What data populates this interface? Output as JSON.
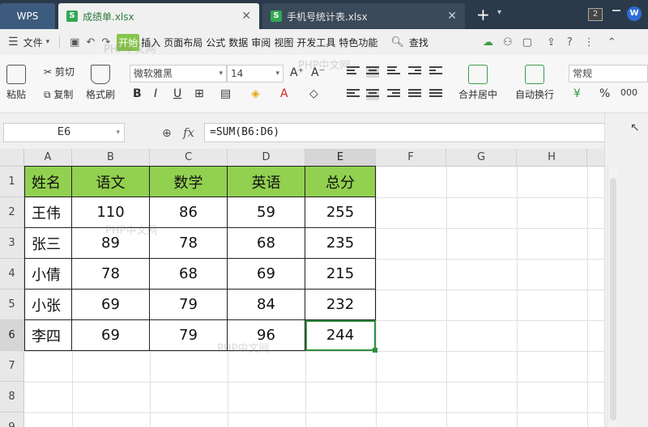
{
  "tabbar": {
    "wps_label": "WPS",
    "tabs": [
      {
        "label": "成绩单.xlsx",
        "icon": "xls-icon",
        "active": true
      },
      {
        "label": "手机号统计表.xlsx",
        "icon": "xls-icon",
        "active": false
      }
    ],
    "window_count": "2",
    "brand_icon": "W"
  },
  "menubar": {
    "file_label": "文件",
    "items": [
      "开始",
      "插入",
      "页面布局",
      "公式",
      "数据",
      "审阅",
      "视图",
      "开发工具",
      "特色功能"
    ],
    "active": "开始",
    "search_label": "查找",
    "help_label": "?"
  },
  "ribbon": {
    "paste": "粘贴",
    "cut": "剪切",
    "copy": "复制",
    "format_painter": "格式刷",
    "font_name": "微软雅黑",
    "font_size": "14",
    "merge_center": "合并居中",
    "wrap_text": "自动换行",
    "number_format": "常规",
    "percent": "%"
  },
  "formulabar": {
    "cell_ref": "E6",
    "fx": "fx",
    "formula": "=SUM(B6:D6)"
  },
  "sheet": {
    "columns": [
      "A",
      "B",
      "C",
      "D",
      "E",
      "F",
      "G",
      "H"
    ],
    "rows": [
      "1",
      "2",
      "3",
      "4",
      "5",
      "6",
      "7",
      "8",
      "9"
    ],
    "header": [
      "姓名",
      "语文",
      "数学",
      "英语",
      "总分"
    ],
    "data": [
      [
        "王伟",
        "110",
        "86",
        "59",
        "255"
      ],
      [
        "张三",
        "89",
        "78",
        "68",
        "235"
      ],
      [
        "小倩",
        "78",
        "68",
        "69",
        "215"
      ],
      [
        "小张",
        "69",
        "79",
        "84",
        "232"
      ],
      [
        "李四",
        "69",
        "79",
        "96",
        "244"
      ]
    ],
    "selected_cell": "E6"
  },
  "colors": {
    "header_fill": "#92d050",
    "selection": "#2f8f3f",
    "active_tab_text": "#2b7a3d"
  }
}
